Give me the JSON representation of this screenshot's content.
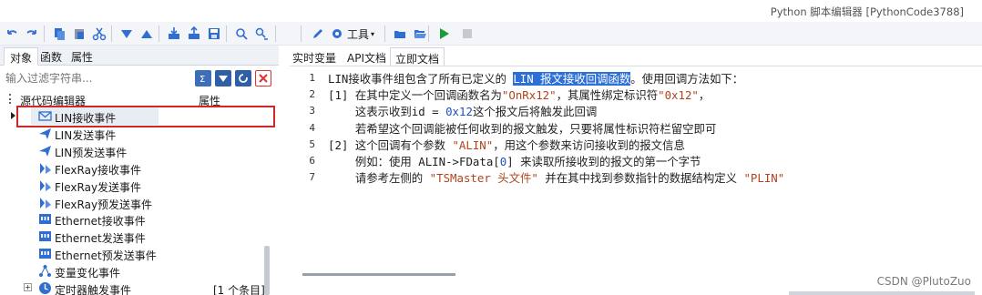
{
  "window": {
    "title": "Python 脚本编辑器 [PythonCode3788]"
  },
  "toolbar": {
    "tools_label": "工具",
    "icons": [
      "undo-icon",
      "redo-icon",
      "copy-icon",
      "paste-icon",
      "cut-icon",
      "move-down-icon",
      "move-up-icon",
      "import-icon",
      "export-icon",
      "save-icon",
      "search-icon",
      "replace-icon",
      "edit-icon",
      "gear-icon",
      "open-icon",
      "open-folder-icon",
      "run-icon",
      "stop-icon"
    ]
  },
  "left": {
    "tabs": [
      "对象",
      "函数",
      "属性"
    ],
    "active_tab": 0,
    "filter_placeholder": "输入过滤字符串...",
    "columns": {
      "name": "源代码编辑器",
      "attr": "属性"
    },
    "items": [
      {
        "label": "LIN接收事件",
        "icon": "envelope-icon",
        "selected": true
      },
      {
        "label": "LIN发送事件",
        "icon": "send-icon"
      },
      {
        "label": "LIN预发送事件",
        "icon": "send-icon"
      },
      {
        "label": "FlexRay接收事件",
        "icon": "flexray-icon"
      },
      {
        "label": "FlexRay发送事件",
        "icon": "flexray-icon"
      },
      {
        "label": "FlexRay预发送事件",
        "icon": "flexray-icon"
      },
      {
        "label": "Ethernet接收事件",
        "icon": "ethernet-icon"
      },
      {
        "label": "Ethernet发送事件",
        "icon": "ethernet-icon"
      },
      {
        "label": "Ethernet预发送事件",
        "icon": "ethernet-icon"
      },
      {
        "label": "变量变化事件",
        "icon": "tree-icon"
      },
      {
        "label": "定时器触发事件",
        "icon": "clock-icon",
        "count": "[1 个条目]"
      }
    ]
  },
  "right": {
    "tabs": [
      "实时变量",
      "API文档",
      "立即文档"
    ],
    "active_tab": 2,
    "lines": [
      {
        "n": "1",
        "parts": [
          [
            "t",
            "LIN接收事件组包含了所有已定义的 "
          ],
          [
            "hl",
            "LIN 报文接收回调函数"
          ],
          [
            "t",
            "。使用回调方法如下："
          ]
        ]
      },
      {
        "n": "2",
        "parts": [
          [
            "t",
            "[1] 在其中定义一个回调函数名为"
          ],
          [
            "str",
            "\"OnRx12\""
          ],
          [
            "t",
            "，其属性绑定标识符"
          ],
          [
            "str",
            "\"0x12\""
          ],
          [
            "t",
            "，"
          ]
        ]
      },
      {
        "n": "3",
        "parts": [
          [
            "t",
            "    这表示收到id = "
          ],
          [
            "num",
            "0x12"
          ],
          [
            "t",
            "这个报文后将触发此回调"
          ]
        ]
      },
      {
        "n": "4",
        "parts": [
          [
            "t",
            "    若希望这个回调能被任何收到的报文触发，只要将属性标识符栏留空即可"
          ]
        ]
      },
      {
        "n": "5",
        "parts": [
          [
            "t",
            "[2] 这个回调有个参数 "
          ],
          [
            "str",
            "\"ALIN\""
          ],
          [
            "t",
            "，用这个参数来访问接收到的报文信息"
          ]
        ]
      },
      {
        "n": "6",
        "parts": [
          [
            "t",
            "    例如：使用 ALIN->FData["
          ],
          [
            "num",
            "0"
          ],
          [
            "t",
            "] 来读取所接收到的报文的第一个字节"
          ]
        ]
      },
      {
        "n": "7",
        "parts": [
          [
            "t",
            "    请参考左侧的 "
          ],
          [
            "str",
            "\"TSMaster 头文件\""
          ],
          [
            "t",
            " 并在其中找到参数指针的数据结构定义 "
          ],
          [
            "str",
            "\"PLIN\""
          ]
        ]
      }
    ]
  },
  "watermark": "CSDN @PlutoZuo"
}
